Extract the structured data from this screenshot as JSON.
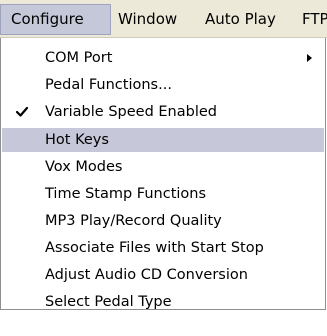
{
  "menubar": {
    "items": [
      {
        "label": "Configure"
      },
      {
        "label": "Window"
      },
      {
        "label": "Auto Play"
      },
      {
        "label": "FTP"
      }
    ]
  },
  "dropdown": {
    "items": [
      {
        "label": "COM Port",
        "submenu": true,
        "checked": false,
        "highlighted": false
      },
      {
        "label": "Pedal Functions...",
        "submenu": false,
        "checked": false,
        "highlighted": false
      },
      {
        "label": "Variable Speed Enabled",
        "submenu": false,
        "checked": true,
        "highlighted": false
      },
      {
        "label": "Hot Keys",
        "submenu": false,
        "checked": false,
        "highlighted": true
      },
      {
        "label": "Vox Modes",
        "submenu": false,
        "checked": false,
        "highlighted": false
      },
      {
        "label": "Time Stamp Functions",
        "submenu": false,
        "checked": false,
        "highlighted": false
      },
      {
        "label": "MP3 Play/Record Quality",
        "submenu": false,
        "checked": false,
        "highlighted": false
      },
      {
        "label": "Associate Files with Start Stop",
        "submenu": false,
        "checked": false,
        "highlighted": false
      },
      {
        "label": "Adjust Audio CD Conversion",
        "submenu": false,
        "checked": false,
        "highlighted": false
      },
      {
        "label": "Select Pedal Type",
        "submenu": false,
        "checked": false,
        "highlighted": false
      }
    ]
  },
  "icons": {
    "check": "checkmark-icon",
    "submenu": "submenu-arrow-icon"
  },
  "colors": {
    "menubar_bg": "#ece9d8",
    "active_menu_bg": "#c5c8d9",
    "highlight_bg": "#c6c7d8"
  }
}
